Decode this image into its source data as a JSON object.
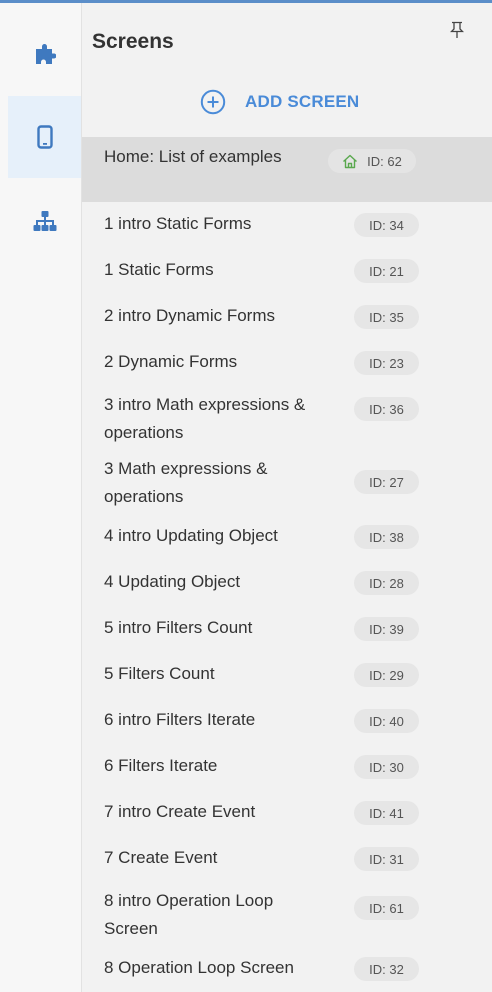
{
  "header": {
    "title": "Screens",
    "add_label": "ADD SCREEN"
  },
  "colors": {
    "accent": "#4a8bd8",
    "home_icon": "#5aa84e",
    "selected_row": "#dcdcdc",
    "rail_active": "#e6f0fa"
  },
  "rail": [
    {
      "icon": "puzzle-icon",
      "active": false
    },
    {
      "icon": "mobile-device-icon",
      "active": true
    },
    {
      "icon": "sitemap-icon",
      "active": false
    }
  ],
  "screens": [
    {
      "name": "Home: List of examples",
      "id": "ID: 62",
      "home": true,
      "selected": true
    },
    {
      "name": "1 intro Static Forms",
      "id": "ID: 34"
    },
    {
      "name": "1 Static Forms",
      "id": "ID: 21"
    },
    {
      "name": "2 intro Dynamic Forms",
      "id": "ID: 35"
    },
    {
      "name": "2 Dynamic Forms",
      "id": "ID: 23"
    },
    {
      "name": "3 intro Math expressions & operations",
      "id": "ID: 36"
    },
    {
      "name": "3 Math expressions & operations",
      "id": "ID: 27"
    },
    {
      "name": "4 intro Updating Object",
      "id": "ID: 38"
    },
    {
      "name": "4 Updating Object",
      "id": "ID: 28"
    },
    {
      "name": "5 intro Filters Count",
      "id": "ID: 39"
    },
    {
      "name": "5 Filters Count",
      "id": "ID: 29"
    },
    {
      "name": "6 intro Filters Iterate",
      "id": "ID: 40"
    },
    {
      "name": "6 Filters Iterate",
      "id": "ID: 30"
    },
    {
      "name": "7 intro Create Event",
      "id": "ID: 41"
    },
    {
      "name": "7 Create Event",
      "id": "ID: 31"
    },
    {
      "name": "8 intro Operation Loop Screen",
      "id": "ID: 61"
    },
    {
      "name": "8 Operation Loop Screen",
      "id": "ID: 32"
    }
  ]
}
